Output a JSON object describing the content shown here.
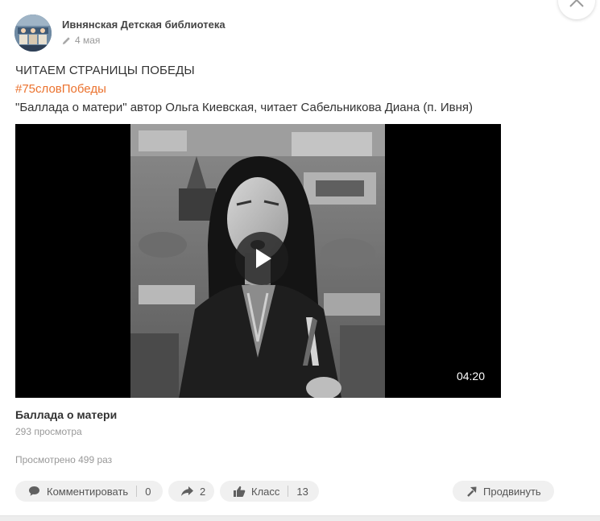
{
  "post": {
    "author": "Ивнянская Детская библиотека",
    "date": "4 мая",
    "title": "ЧИТАЕМ СТРАНИЦЫ ПОБЕДЫ",
    "hashtag": "#75словПобеды",
    "text": "\"Баллада о матери\" автор Ольга Киевская, читает Сабельникова Диана (п. Ивня)"
  },
  "video": {
    "duration": "04:20",
    "title": "Баллада о матери",
    "views": "293 просмотра"
  },
  "stats": {
    "seen": "Просмотрено 499 раз"
  },
  "actions": {
    "comment_label": "Комментировать",
    "comment_count": "0",
    "share_count": "2",
    "like_label": "Класс",
    "like_count": "13",
    "promote_label": "Продвинуть"
  },
  "colors": {
    "accent": "#eb722e",
    "muted": "#999999",
    "pill_bg": "#f0f0f0"
  },
  "icons": [
    "pencil-icon",
    "close-icon",
    "play-icon",
    "comment-icon",
    "share-icon",
    "like-icon",
    "promote-icon"
  ]
}
